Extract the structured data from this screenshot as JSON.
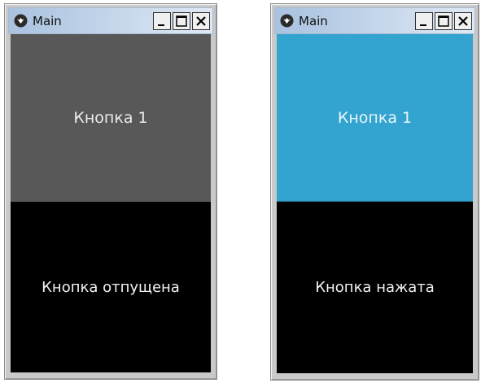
{
  "windows": [
    {
      "title": "Main",
      "controls": {
        "minimize": "minimize",
        "maximize": "maximize",
        "close": "close"
      },
      "button": {
        "label": "Кнопка 1",
        "state": "normal",
        "color": "#585858"
      },
      "label": {
        "text": "Кнопка отпущена"
      }
    },
    {
      "title": "Main",
      "controls": {
        "minimize": "minimize",
        "maximize": "maximize",
        "close": "close"
      },
      "button": {
        "label": "Кнопка 1",
        "state": "pressed",
        "color": "#33a3cf"
      },
      "label": {
        "text": "Кнопка нажата"
      }
    }
  ],
  "icons": [
    "kivy-app-icon",
    "minimize-icon",
    "maximize-icon",
    "close-icon"
  ]
}
